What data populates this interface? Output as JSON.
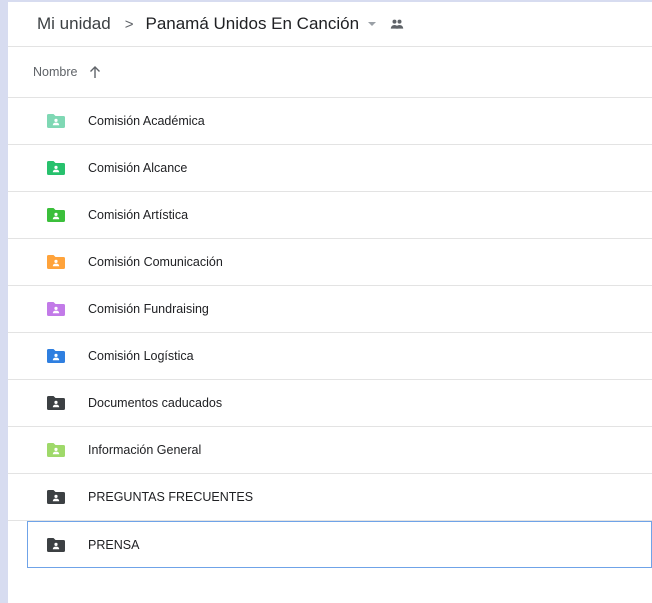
{
  "header": {
    "root": "Mi unidad",
    "separator": ">",
    "current": "Panamá Unidos En Canción"
  },
  "list_header": {
    "sort_label": "Nombre"
  },
  "folders": [
    {
      "name": "Comisión Académica",
      "color": "#7fd8b4"
    },
    {
      "name": "Comisión Alcance",
      "color": "#27c16d"
    },
    {
      "name": "Comisión Artística",
      "color": "#3bbf3b"
    },
    {
      "name": "Comisión Comunicación",
      "color": "#ffa33b"
    },
    {
      "name": "Comisión Fundraising",
      "color": "#c27ae8"
    },
    {
      "name": "Comisión Logística",
      "color": "#2f7fe0"
    },
    {
      "name": "Documentos caducados",
      "color": "#3c4043"
    },
    {
      "name": "Información General",
      "color": "#9fd96a"
    },
    {
      "name": "PREGUNTAS FRECUENTES",
      "color": "#3c4043"
    },
    {
      "name": "PRENSA",
      "color": "#3c4043",
      "selected": true
    }
  ]
}
